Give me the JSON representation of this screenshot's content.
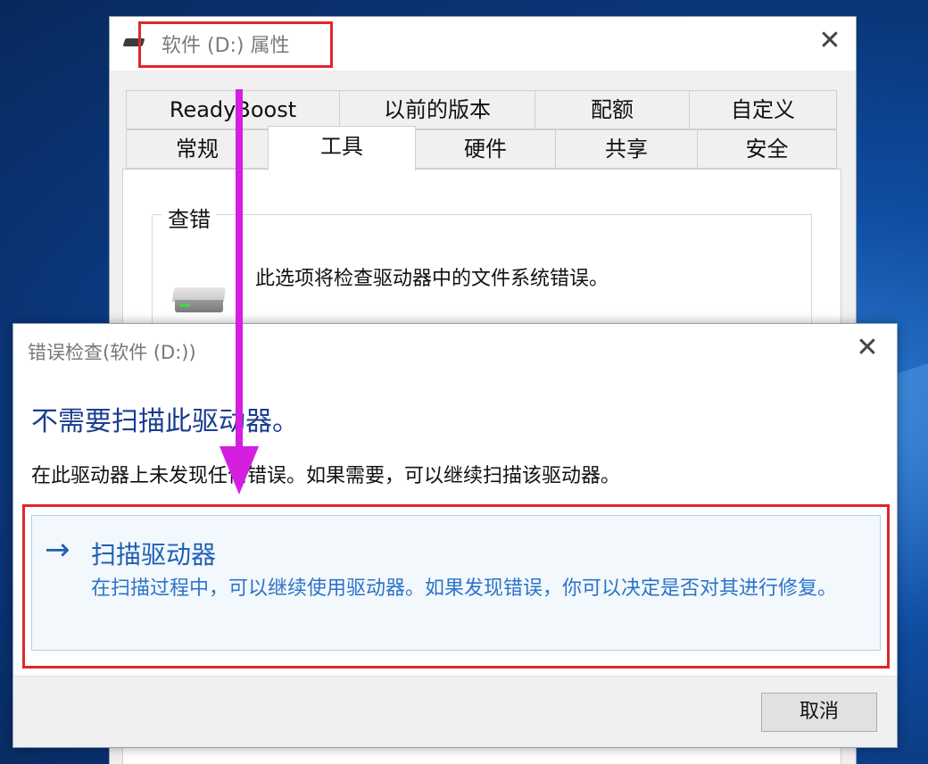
{
  "properties_window": {
    "title": "软件 (D:) 属性",
    "close_glyph": "✕",
    "tabs_row1": [
      "ReadyBoost",
      "以前的版本",
      "配额",
      "自定义"
    ],
    "tabs_row2": [
      "常规",
      "工具",
      "硬件",
      "共享",
      "安全"
    ],
    "active_tab": "工具",
    "group_title": "查错",
    "check_description": "此选项将检查驱动器中的文件系统错误。",
    "drive_icon": "hard-drive-icon"
  },
  "error_dialog": {
    "title": "错误检查(软件 (D:))",
    "close_glyph": "✕",
    "heading": "不需要扫描此驱动器。",
    "message": "在此驱动器上未发现任何错误。如果需要，可以继续扫描该驱动器。",
    "action": {
      "arrow_glyph": "→",
      "title": "扫描驱动器",
      "description": "在扫描过程中，可以继续使用驱动器。如果发现错误，你可以决定是否对其进行修复。"
    },
    "cancel_label": "取消"
  },
  "colors": {
    "highlight_box": "#e0262a",
    "annotation_arrow": "#d41fe0",
    "heading_blue": "#1a3d8f",
    "link_blue": "#1d5fb5"
  }
}
